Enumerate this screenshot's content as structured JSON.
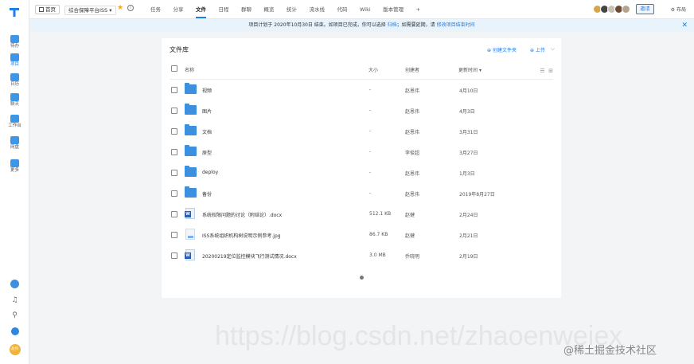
{
  "rail": {
    "items": [
      {
        "label": "待办",
        "icon": "check-icon"
      },
      {
        "label": "项目",
        "icon": "project-icon"
      },
      {
        "label": "日历",
        "icon": "calendar-icon"
      },
      {
        "label": "聊天",
        "icon": "chat-icon"
      },
      {
        "label": "工作台",
        "icon": "desktop-icon"
      },
      {
        "label": "网盘",
        "icon": "drive-icon"
      },
      {
        "label": "更多",
        "icon": "more-icon"
      }
    ],
    "avatar_text": "赵伟"
  },
  "topbar": {
    "home_label": "首页",
    "project_label": "综合保障平台ISS",
    "tabs": [
      "任务",
      "分享",
      "文件",
      "日程",
      "群聊",
      "概览",
      "统计",
      "流水线",
      "代码",
      "Wiki",
      "版本管理",
      "+"
    ],
    "active_tab": "文件",
    "invite_label": "邀请",
    "layout_label": "布局"
  },
  "notice": {
    "text": "项目计划于 2020年10月30日 结束。如项目已完成，你可以选择 ",
    "link1": "归档",
    "text2": "；如需要延期，请 ",
    "link2": "修改项目结束时间"
  },
  "files": {
    "title": "文件库",
    "new_folder_label": "创建文件夹",
    "upload_label": "上传",
    "columns": {
      "name": "名称",
      "size": "大小",
      "owner": "创建者",
      "time": "更新时间"
    },
    "rows": [
      {
        "type": "folder",
        "name": "视频",
        "size": "-",
        "owner": "赵恩伟",
        "time": "4月10日"
      },
      {
        "type": "folder",
        "name": "图片",
        "size": "-",
        "owner": "赵恩伟",
        "time": "4月3日"
      },
      {
        "type": "folder",
        "name": "文档",
        "size": "-",
        "owner": "赵恩伟",
        "time": "3月31日"
      },
      {
        "type": "folder",
        "name": "原型",
        "size": "-",
        "owner": "李俊超",
        "time": "3月27日"
      },
      {
        "type": "folder",
        "name": "deploy",
        "size": "-",
        "owner": "赵恩伟",
        "time": "1月3日"
      },
      {
        "type": "folder",
        "name": "备份",
        "size": "-",
        "owner": "赵恩伟",
        "time": "2019年8月27日"
      },
      {
        "type": "word",
        "name": "系统权限问题的讨论（附结论）.docx",
        "size": "512.1 KB",
        "owner": "赵健",
        "time": "2月24日"
      },
      {
        "type": "image",
        "name": "ISS系统组织机构树说明示例参考.jpg",
        "size": "86.7 KB",
        "owner": "赵健",
        "time": "2月21日"
      },
      {
        "type": "word",
        "name": "20200219定位监控模块飞行测试情况.docx",
        "size": "3.0 MB",
        "owner": "乔晓明",
        "time": "2月19日"
      }
    ]
  },
  "watermark": "https://blog.csdn.net/zhaoenweiex",
  "corner_watermark": "@稀土掘金技术社区"
}
